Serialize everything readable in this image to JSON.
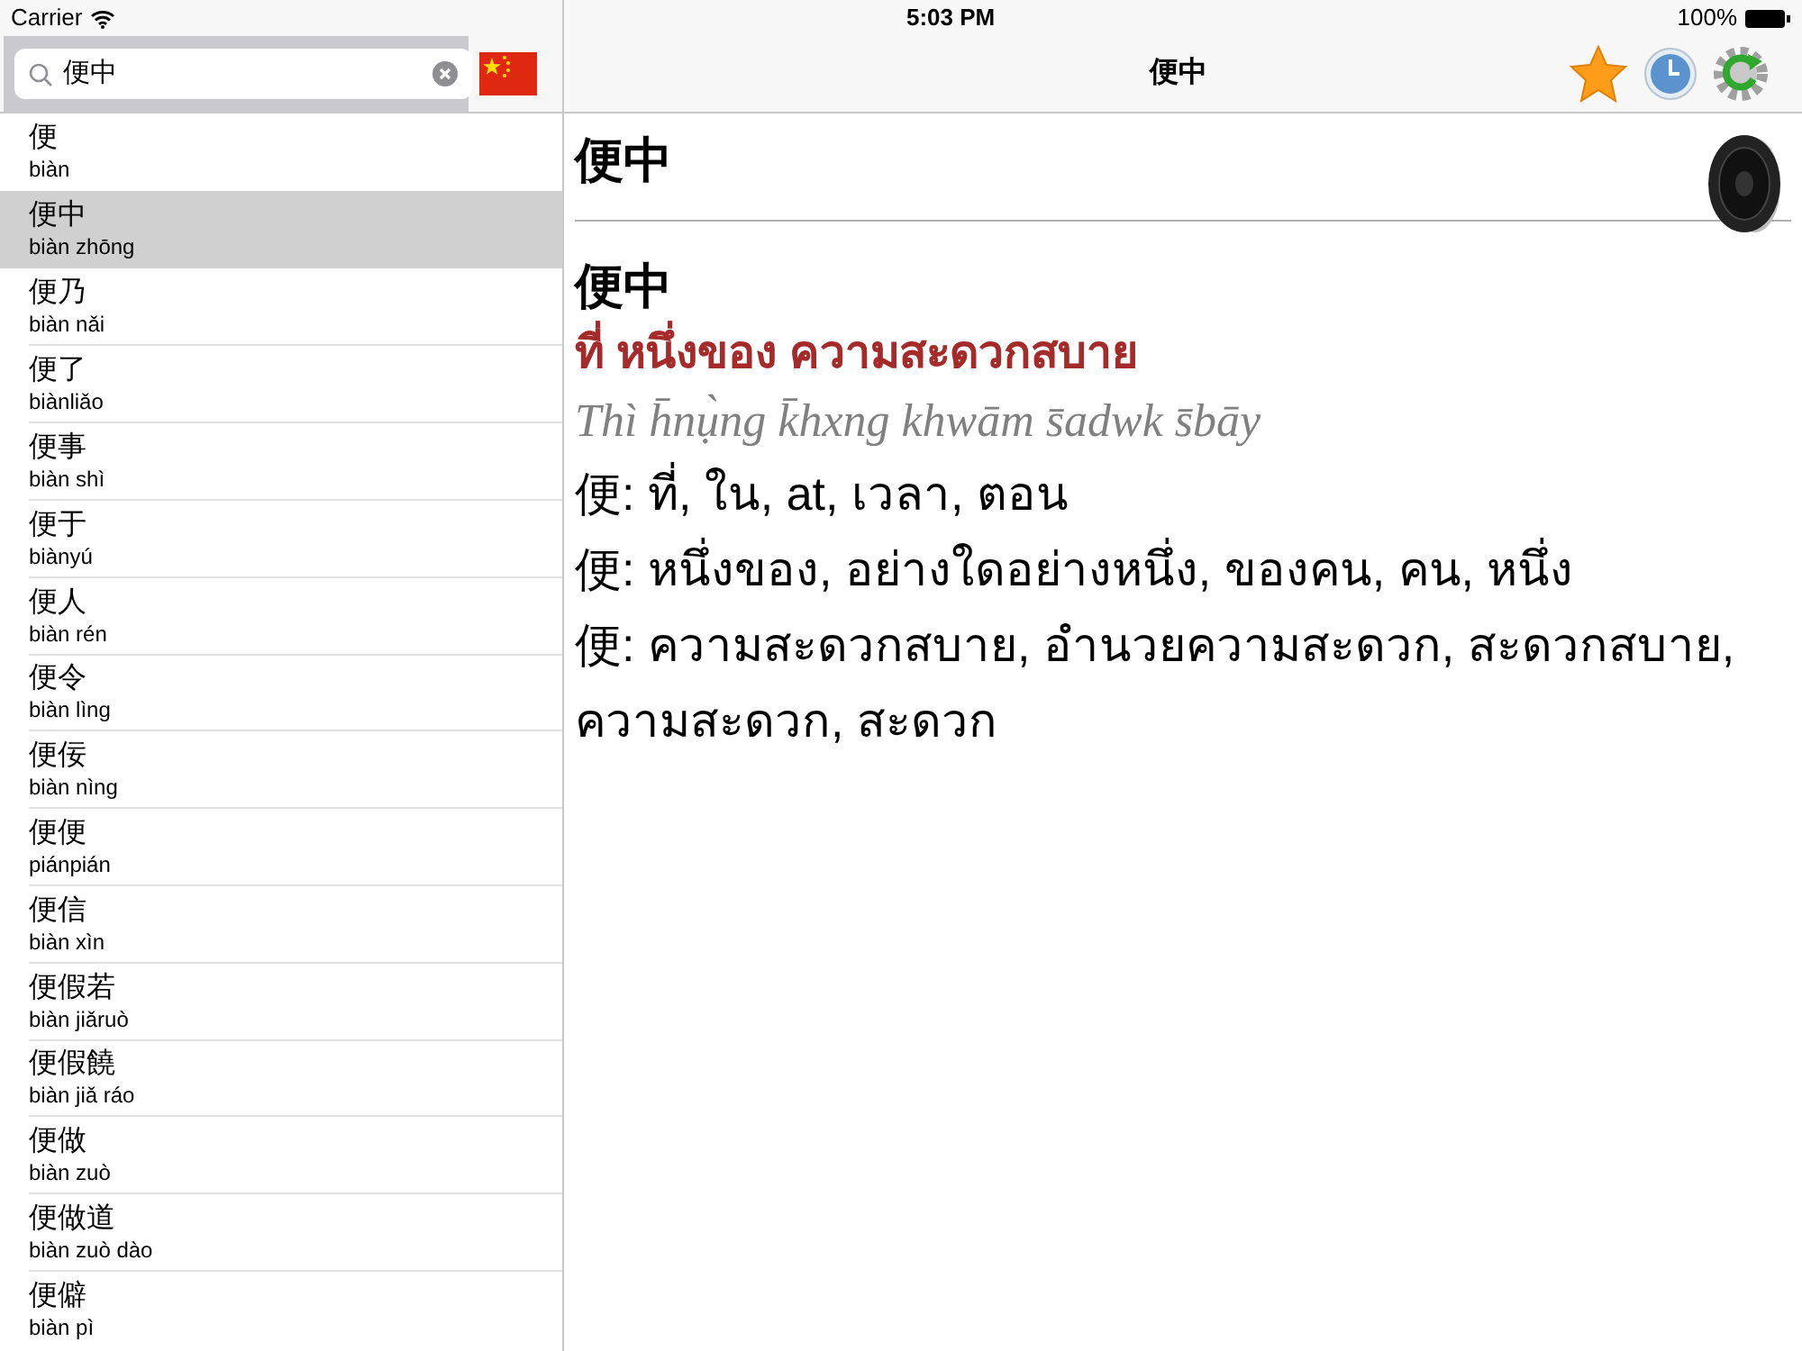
{
  "status_bar": {
    "carrier": "Carrier",
    "time": "5:03 PM",
    "battery": "100%"
  },
  "search": {
    "value": "便中"
  },
  "nav": {
    "title": "便中"
  },
  "list": [
    {
      "hanzi": "便",
      "pinyin": "biàn",
      "selected": false
    },
    {
      "hanzi": "便中",
      "pinyin": "biàn zhōng",
      "selected": true
    },
    {
      "hanzi": "便乃",
      "pinyin": "biàn nǎi",
      "selected": false
    },
    {
      "hanzi": "便了",
      "pinyin": "biànliǎo",
      "selected": false
    },
    {
      "hanzi": "便事",
      "pinyin": "biàn shì",
      "selected": false
    },
    {
      "hanzi": "便于",
      "pinyin": "biànyú",
      "selected": false
    },
    {
      "hanzi": "便人",
      "pinyin": "biàn rén",
      "selected": false
    },
    {
      "hanzi": "便令",
      "pinyin": "biàn lìng",
      "selected": false
    },
    {
      "hanzi": "便佞",
      "pinyin": "biàn nìng",
      "selected": false
    },
    {
      "hanzi": "便便",
      "pinyin": "piánpián",
      "selected": false
    },
    {
      "hanzi": "便信",
      "pinyin": "biàn xìn",
      "selected": false
    },
    {
      "hanzi": "便假若",
      "pinyin": "biàn jiǎruò",
      "selected": false
    },
    {
      "hanzi": "便假饒",
      "pinyin": "biàn jiǎ ráo",
      "selected": false
    },
    {
      "hanzi": "便做",
      "pinyin": "biàn zuò",
      "selected": false
    },
    {
      "hanzi": "便做道",
      "pinyin": "biàn zuò dào",
      "selected": false
    },
    {
      "hanzi": "便僻",
      "pinyin": "biàn pì",
      "selected": false
    }
  ],
  "entry": {
    "headword": "便中",
    "word": "便中",
    "translation": "ที่ หนึ่งของ ความสะดวกสบาย",
    "transliteration": "Thì h̄nụ̀ng k̄hxng khwām s̄adwk s̄bāy",
    "definitions": [
      "便: ที่, ใน, at, เวลา, ตอน",
      "便: หนึ่งของ, อย่างใดอย่างหนึ่ง, ของคน, คน, หนึ่ง",
      "便: ความสะดวกสบาย, อำนวยความสะดวก, สะดวกสบาย, ความสะดวก, สะดวก"
    ]
  }
}
